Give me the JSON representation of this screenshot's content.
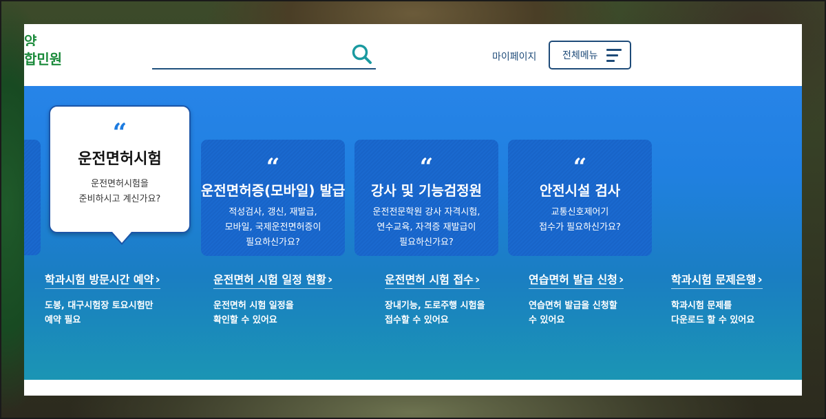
{
  "header": {
    "logo_line1": "양",
    "logo_line2": "합민원",
    "search_value": "",
    "my_page": "마이페이지",
    "all_menu": "전체메뉴"
  },
  "cards": [
    {
      "title": "운전면허시험",
      "desc_line1": "운전면허시험을",
      "desc_line2": "준비하시고 계신가요?",
      "active": true
    },
    {
      "title": "운전면허증(모바일) 발급",
      "desc_line1": "적성검사, 갱신, 재발급,",
      "desc_line2": "모바일, 국제운전면허증이",
      "desc_line3": "필요하신가요?"
    },
    {
      "title": "강사 및 기능검정원",
      "desc_line1": "운전전문학원 강사 자격시험,",
      "desc_line2": "연수교육, 자격증 재발급이",
      "desc_line3": "필요하신가요?"
    },
    {
      "title": "안전시설 검사",
      "desc_line1": "교통신호제어기",
      "desc_line2": "접수가 필요하신가요?"
    }
  ],
  "quote_mark": "“",
  "chevron": "›",
  "links": [
    {
      "title": "학과시험 방문시간 예약",
      "desc_line1": "도봉, 대구시험장 토요시험만",
      "desc_line2": "예약 필요"
    },
    {
      "title": "운전면허 시험 일정 현황",
      "desc_line1": "운전면허 시험 일정을",
      "desc_line2": "확인할 수 있어요"
    },
    {
      "title": "운전면허 시험 접수",
      "desc_line1": "장내기능, 도로주행 시험을",
      "desc_line2": "접수할 수 있어요"
    },
    {
      "title": "연습면허 발급 신청",
      "desc_line1": "연습면허 발급을 신청할",
      "desc_line2": "수 있어요"
    },
    {
      "title": "학과시험 문제은행",
      "desc_line1": "학과시험 문제를",
      "desc_line2": "다운로드 할 수 있어요"
    }
  ],
  "colors": {
    "panel_top": "#2784e8",
    "panel_bottom": "#1b95b4",
    "card_bg": "#1864c8",
    "accent_navy": "#1d4a78",
    "search_icon": "#1a9aa0",
    "logo_green": "#1a8a3a"
  }
}
